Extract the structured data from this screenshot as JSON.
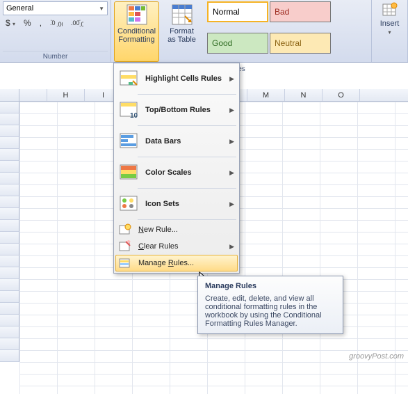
{
  "ribbon": {
    "number_format": "General",
    "number_group_label": "Number",
    "conditional_formatting_label": "Conditional\nFormatting",
    "format_as_table_label": "Format\nas Table",
    "styles_truncated_label": "les",
    "insert_label": "Insert",
    "style_cells": {
      "normal": "Normal",
      "bad": "Bad",
      "good": "Good",
      "neutral": "Neutral"
    }
  },
  "columns": [
    "H",
    "I",
    "",
    "",
    "M",
    "N",
    "O"
  ],
  "menu": {
    "highlight": "Highlight Cells Rules",
    "topbottom": "Top/Bottom Rules",
    "databars": "Data Bars",
    "colorscales": "Color Scales",
    "iconsets": "Icon Sets",
    "newrule": "New Rule...",
    "clearrules": "Clear Rules",
    "managerules": "Manage Rules..."
  },
  "tooltip": {
    "title": "Manage Rules",
    "body": "Create, edit, delete, and view all conditional formatting rules in the workbook by using the Conditional Formatting Rules Manager."
  },
  "watermark": "groovyPost.com"
}
